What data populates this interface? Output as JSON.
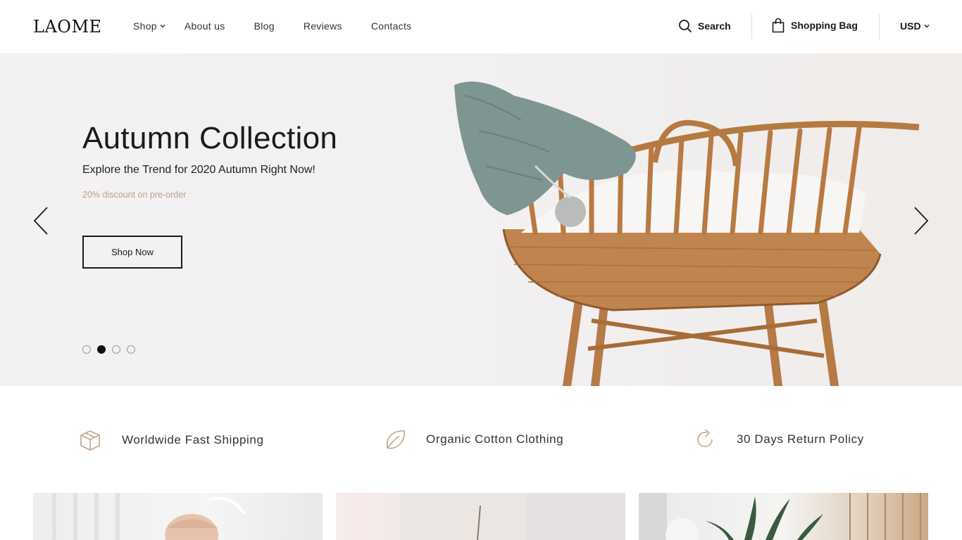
{
  "brand": {
    "logo_text": "LAOME"
  },
  "nav": {
    "items": [
      {
        "label": "Shop",
        "has_dropdown": true
      },
      {
        "label": "About us"
      },
      {
        "label": "Blog"
      },
      {
        "label": "Reviews"
      },
      {
        "label": "Contacts"
      }
    ]
  },
  "header_actions": {
    "search_label": "Search",
    "bag_label": "Shopping Bag",
    "currency_label": "USD"
  },
  "hero": {
    "title": "Autumn Collection",
    "subtitle": "Explore the Trend for 2020 Autumn Right Now!",
    "discount": "20% discount on pre-order",
    "cta_label": "Shop Now",
    "slides_total": 4,
    "active_slide": 2,
    "image_subject": "wicker-bassinet-with-knit-hat"
  },
  "features": [
    {
      "icon": "box-icon",
      "label": "Worldwide Fast Shipping"
    },
    {
      "icon": "leaf-icon",
      "label": "Organic Cotton Clothing"
    },
    {
      "icon": "return-arrow-icon",
      "label": "30 Days Return Policy"
    }
  ],
  "colors": {
    "accent": "#b8a291",
    "text": "#1b1b1b",
    "hero_bg": "#f2f0f1",
    "icon_tan": "#c4a48a"
  }
}
